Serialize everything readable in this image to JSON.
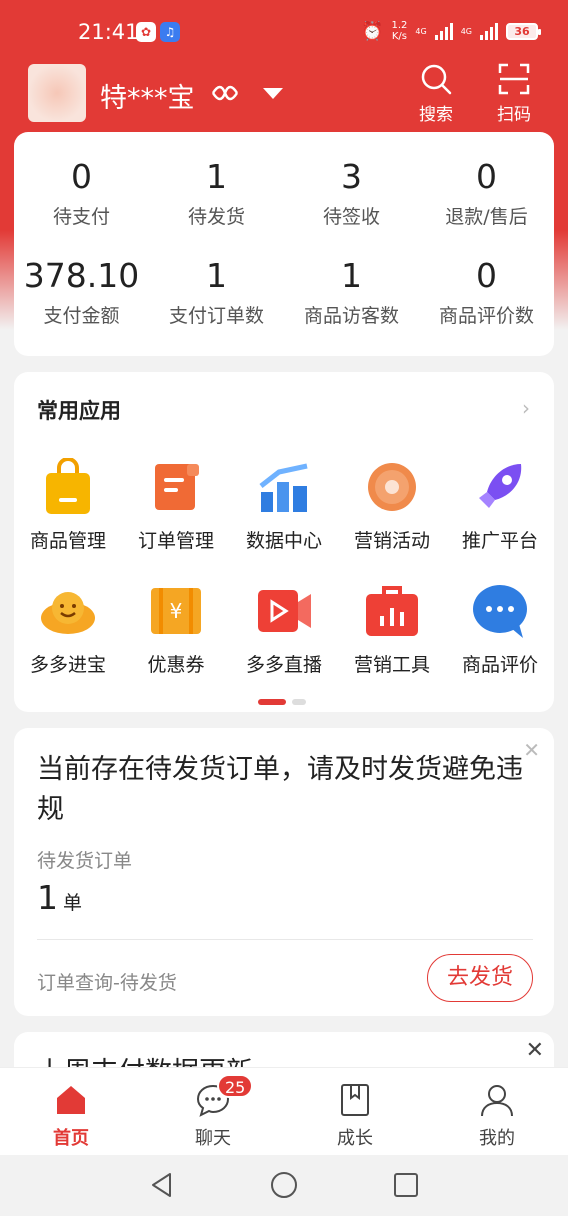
{
  "status_bar": {
    "time": "21:41",
    "net_speed_value": "1.2",
    "net_speed_unit": "K/s",
    "network_1": "4G",
    "network_2": "4G",
    "battery": "36"
  },
  "header": {
    "store_name": "特***宝",
    "search_label": "搜索",
    "scan_label": "扫码"
  },
  "order_stats": [
    {
      "value": "0",
      "label": "待支付"
    },
    {
      "value": "1",
      "label": "待发货"
    },
    {
      "value": "3",
      "label": "待签收"
    },
    {
      "value": "0",
      "label": "退款/售后"
    }
  ],
  "sales_stats": [
    {
      "value": "378.10",
      "label": "支付金额"
    },
    {
      "value": "1",
      "label": "支付订单数"
    },
    {
      "value": "1",
      "label": "商品访客数"
    },
    {
      "value": "0",
      "label": "商品评价数"
    }
  ],
  "apps": {
    "title": "常用应用",
    "more_icon": "chevron-right-icon",
    "items": [
      {
        "label": "商品管理",
        "icon": "shopping-bag-icon",
        "color": "#f7b500"
      },
      {
        "label": "订单管理",
        "icon": "order-scroll-icon",
        "color": "#f06a35"
      },
      {
        "label": "数据中心",
        "icon": "data-chart-icon",
        "color": "#2f7de1"
      },
      {
        "label": "营销活动",
        "icon": "marketing-badge-icon",
        "color": "#f08a4b"
      },
      {
        "label": "推广平台",
        "icon": "rocket-icon",
        "color": "#7b4ff2"
      },
      {
        "label": "多多进宝",
        "icon": "ingot-icon",
        "color": "#f6a623"
      },
      {
        "label": "优惠券",
        "icon": "coupon-icon",
        "color": "#f5a623"
      },
      {
        "label": "多多直播",
        "icon": "live-video-icon",
        "color": "#ee4036"
      },
      {
        "label": "营销工具",
        "icon": "toolbox-icon",
        "color": "#ee4036"
      },
      {
        "label": "商品评价",
        "icon": "chat-bubble-icon",
        "color": "#2f7de1"
      }
    ],
    "page_indicator": {
      "active": 0,
      "count": 2
    }
  },
  "notice": {
    "title": "当前存在待发货订单，请及时发货避免违规",
    "subtitle": "待发货订单",
    "count": "1",
    "unit": "单",
    "link_text": "订单查询-待发货",
    "action_label": "去发货"
  },
  "partial_card": {
    "title": "上周支付数据更新"
  },
  "bottom_nav": [
    {
      "label": "首页",
      "icon": "home-icon",
      "active": true
    },
    {
      "label": "聊天",
      "icon": "chat-icon",
      "badge": "25"
    },
    {
      "label": "成长",
      "icon": "book-icon"
    },
    {
      "label": "我的",
      "icon": "user-icon"
    }
  ],
  "colors": {
    "brand": "#e23a36",
    "background": "#f2f2f2"
  }
}
